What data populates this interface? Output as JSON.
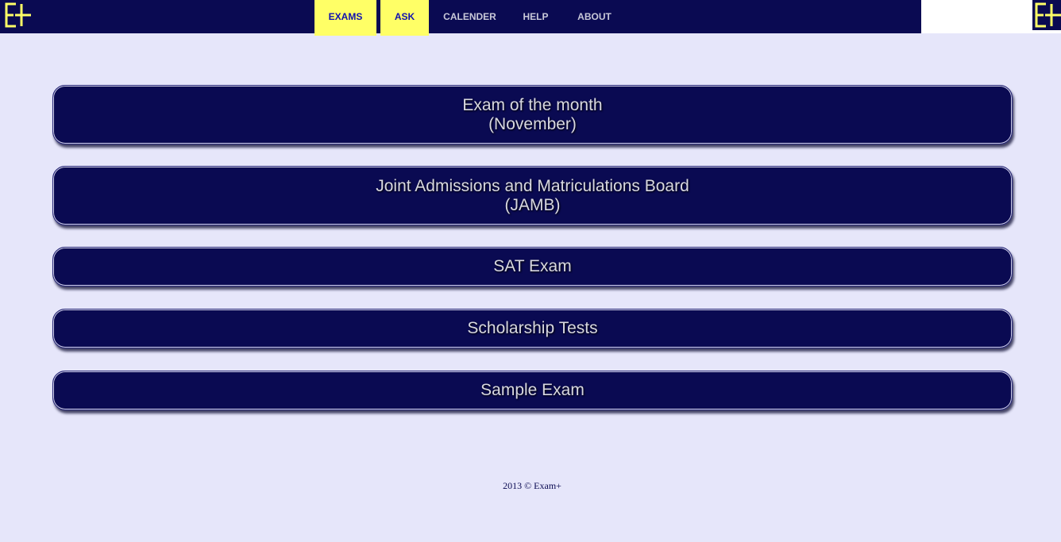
{
  "header": {
    "logo_left_icon": "exam-plus-logo-icon",
    "logo_right_icon": "exam-plus-logo-icon",
    "brand_color": "#0a0a52",
    "logo_color": "#ffff66"
  },
  "nav": {
    "items": [
      {
        "label": "EXAMS",
        "active": true
      },
      {
        "label": "ASK",
        "active": true
      },
      {
        "label": "CALENDER",
        "active": false
      },
      {
        "label": "HELP",
        "active": false
      },
      {
        "label": "ABOUT",
        "active": false
      }
    ],
    "active_bg": "#ffff66"
  },
  "main": {
    "exams": [
      {
        "line1": "Exam of the month",
        "line2": "(November)"
      },
      {
        "line1": "Joint Admissions and Matriculations Board",
        "line2": "(JAMB)"
      },
      {
        "line1": "SAT Exam"
      },
      {
        "line1": "Scholarship Tests"
      },
      {
        "line1": "Sample Exam"
      }
    ]
  },
  "footer": {
    "text": "2013 © Exam+"
  }
}
